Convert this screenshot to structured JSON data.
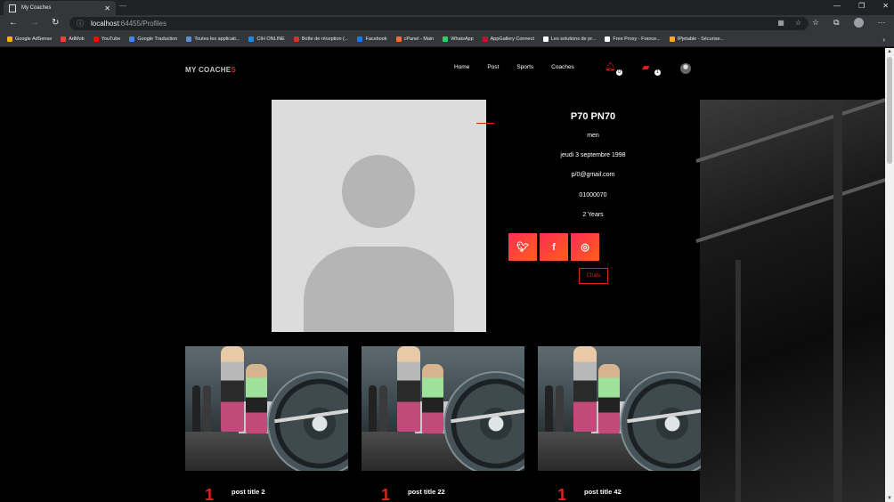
{
  "browser": {
    "tab_title": "My Coaches",
    "url_host": "localhost",
    "url_path": ":64455/Profiles",
    "bookmarks": [
      {
        "label": "Google AdSense",
        "color": "#f4b400"
      },
      {
        "label": "AdMob",
        "color": "#ea4335"
      },
      {
        "label": "YouTube",
        "color": "#ff0000"
      },
      {
        "label": "Google Traduction",
        "color": "#4285f4"
      },
      {
        "label": "Toutes les applicati...",
        "color": "#5f8dd3"
      },
      {
        "label": "CIH ONLINE",
        "color": "#1e88e5"
      },
      {
        "label": "Boîte de réception (...",
        "color": "#d93025"
      },
      {
        "label": "Facebook",
        "color": "#1877f2"
      },
      {
        "label": "cPanel - Main",
        "color": "#ff6c2c"
      },
      {
        "label": "WhatsApp",
        "color": "#25d366"
      },
      {
        "label": "AppGallery Connect",
        "color": "#cf0a2c"
      },
      {
        "label": "Les solutions de pr...",
        "color": "#ffffff"
      },
      {
        "label": "Free Proxy - France...",
        "color": "#ffffff"
      },
      {
        "label": "IPjetable - Sécurise...",
        "color": "#f9a825"
      }
    ]
  },
  "site": {
    "logo_main": "MY COACHE",
    "logo_accent": "S",
    "nav": [
      "Home",
      "Post",
      "Sports",
      "Coaches"
    ],
    "notif_badge": "0",
    "msg_badge": "1"
  },
  "profile": {
    "name": "P70   PN70",
    "gender": "men",
    "birthdate": "jeudi 3 septembre 1998",
    "email": "p/0@gmail.com",
    "phone": "01000070",
    "experience": "2 Years",
    "social": [
      "twitter-icon",
      "facebook-icon",
      "instagram-icon"
    ],
    "chats_label": "Chats"
  },
  "posts": [
    {
      "number": "1",
      "title": "post title 2"
    },
    {
      "number": "1",
      "title": "post title 22"
    },
    {
      "number": "1",
      "title": "post title 42"
    }
  ]
}
